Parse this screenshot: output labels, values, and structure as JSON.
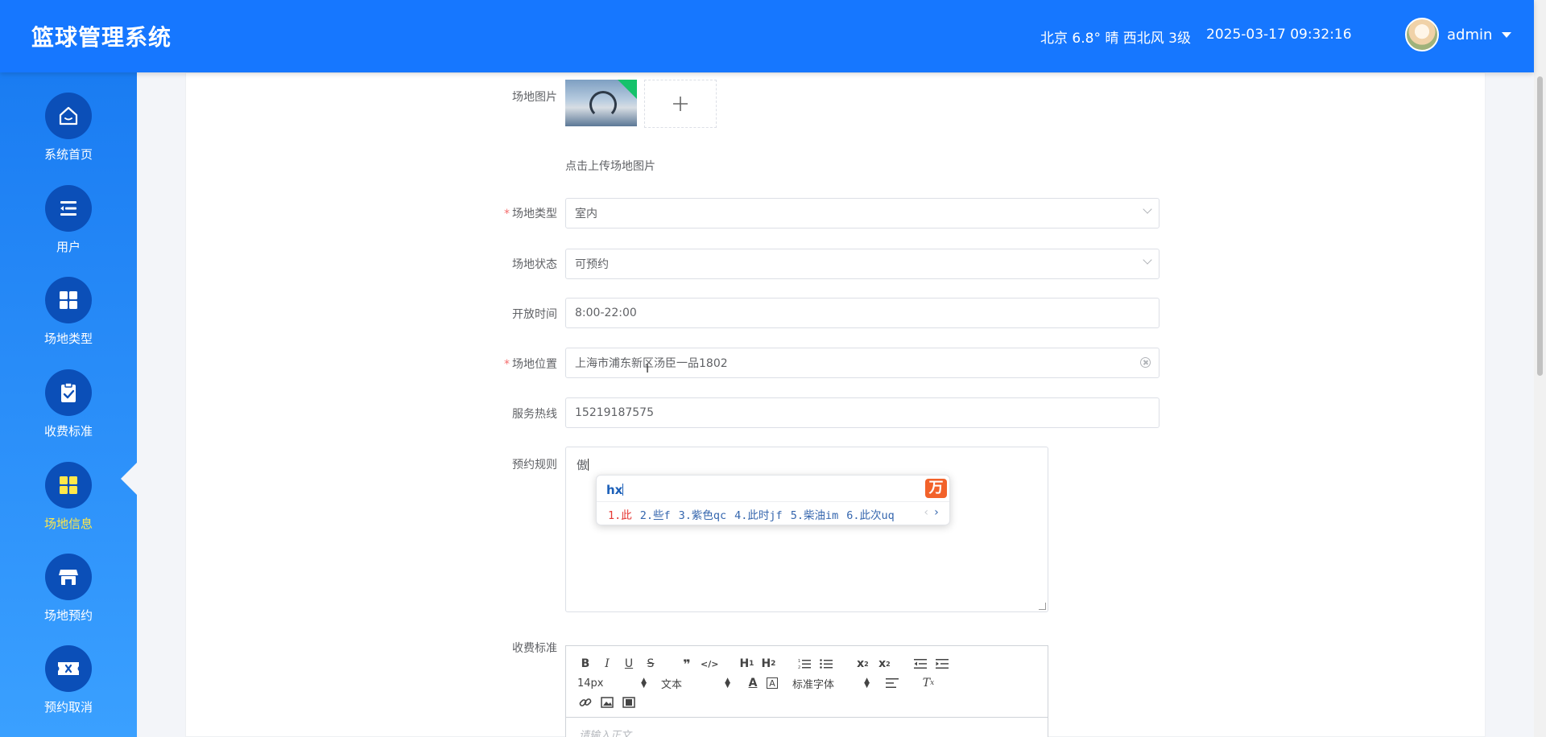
{
  "header": {
    "app_title": "篮球管理系统",
    "weather": "北京 6.8° 晴 西北风 3级",
    "datetime": "2025-03-17 09:32:16",
    "user_name": "admin"
  },
  "sidebar": {
    "items": [
      {
        "label": "系统首页",
        "icon": "home-icon"
      },
      {
        "label": "用户",
        "icon": "user-list-icon"
      },
      {
        "label": "场地类型",
        "icon": "grid-icon"
      },
      {
        "label": "收费标准",
        "icon": "clipboard-check-icon"
      },
      {
        "label": "场地信息",
        "icon": "grid-icon",
        "active": true
      },
      {
        "label": "场地预约",
        "icon": "store-icon"
      },
      {
        "label": "预约取消",
        "icon": "ticket-icon"
      }
    ]
  },
  "form": {
    "image_label": "场地图片",
    "image_hint": "点击上传场地图片",
    "type_label": "场地类型",
    "type_value": "室内",
    "status_label": "场地状态",
    "status_value": "可预约",
    "hours_label": "开放时间",
    "hours_value": "8:00-22:00",
    "location_label": "场地位置",
    "location_value": "上海市浦东新区汤臣一品1802",
    "hotline_label": "服务热线",
    "hotline_value": "15219187575",
    "rules_label": "预约规则",
    "rules_value": "傲",
    "fee_label": "收费标准",
    "required_mark": "*"
  },
  "ime": {
    "composition": "hx",
    "logo": "万",
    "candidates": [
      "1.此",
      "2.些f",
      "3.紫色qc",
      "4.此时jf",
      "5.柴油im",
      "6.此次uq"
    ],
    "pager_prev": "‹",
    "pager_next": "›"
  },
  "editor": {
    "font_size": "14px",
    "block_format": "文本",
    "font_family": "标准字体",
    "placeholder": "请输入正文..."
  },
  "colors": {
    "header_bg": "#1677ff",
    "sidebar_top": "#1a7cf2",
    "sidebar_bottom": "#3aa0ff",
    "nav_circle": "#0b4fb8",
    "active_label": "#ffe84a",
    "required": "#f56c6c"
  }
}
